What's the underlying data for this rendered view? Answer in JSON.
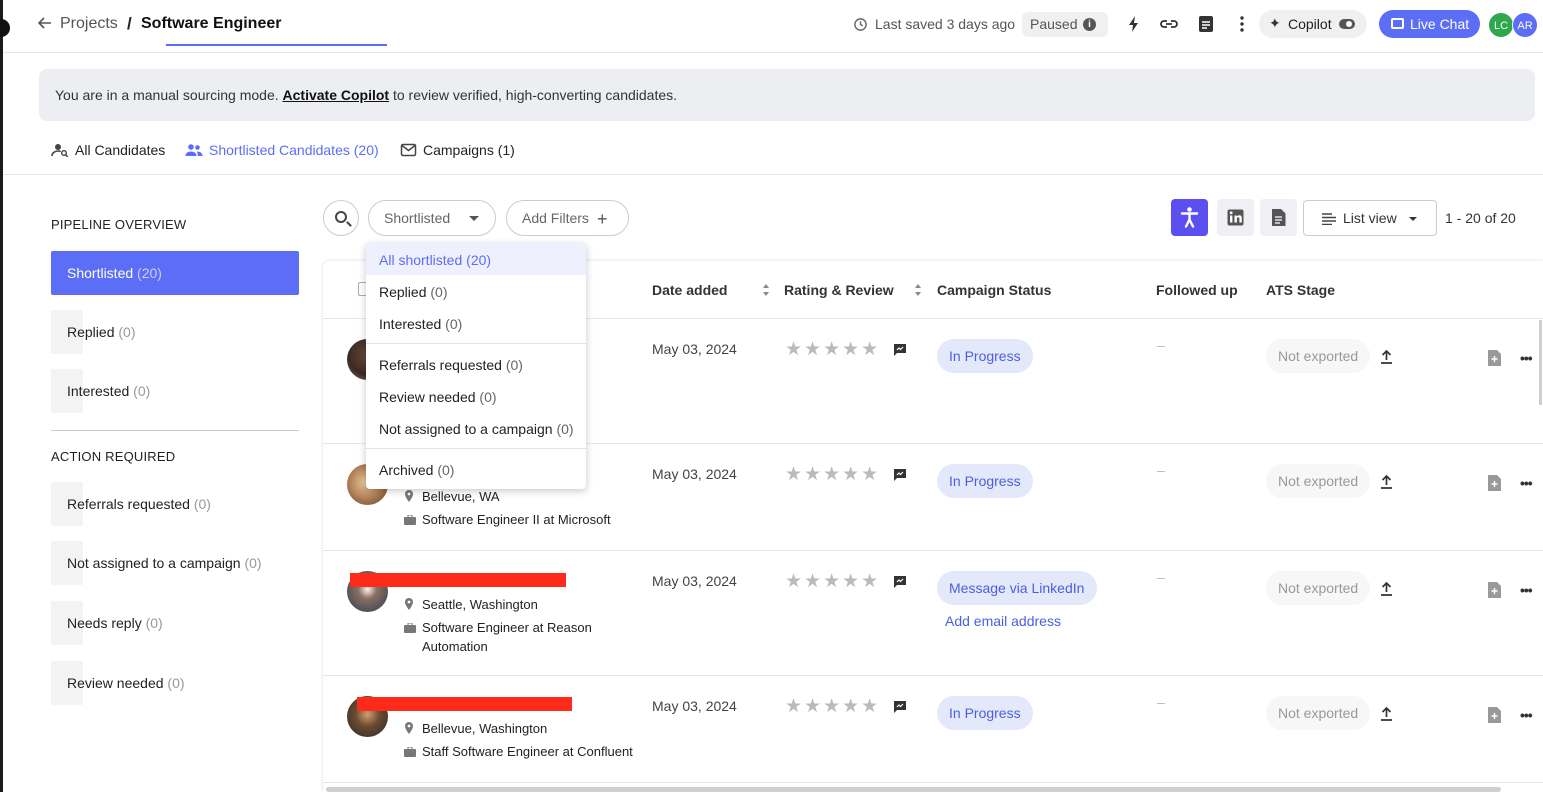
{
  "header": {
    "breadcrumb_parent": "Projects",
    "breadcrumb_separator": "/",
    "project_title": "Software Engineer",
    "last_saved": "Last saved 3 days ago",
    "status": "Paused",
    "copilot_label": "Copilot",
    "live_chat_label": "Live Chat",
    "avatars": [
      "LC",
      "AR"
    ]
  },
  "banner": {
    "text_before": "You are in a manual sourcing mode. ",
    "link": "Activate Copilot",
    "text_after": " to review verified, high-converting candidates."
  },
  "tabs": [
    {
      "label": "All Candidates",
      "active": false
    },
    {
      "label": "Shortlisted Candidates (20)",
      "active": true
    },
    {
      "label": "Campaigns (1)",
      "active": false
    }
  ],
  "sidebar": {
    "pipeline_title": "PIPELINE OVERVIEW",
    "pipeline_items": [
      {
        "label": "Shortlisted",
        "count": "(20)",
        "active": true
      },
      {
        "label": "Replied",
        "count": "(0)",
        "active": false
      },
      {
        "label": "Interested",
        "count": "(0)",
        "active": false
      }
    ],
    "action_title": "ACTION REQUIRED",
    "action_items": [
      {
        "label": "Referrals requested",
        "count": "(0)"
      },
      {
        "label": "Not assigned to a campaign",
        "count": "(0)"
      },
      {
        "label": "Needs reply",
        "count": "(0)"
      },
      {
        "label": "Review needed",
        "count": "(0)"
      }
    ]
  },
  "toolbar": {
    "filter_value": "Shortlisted",
    "add_filters_label": "Add Filters",
    "view_label": "List view",
    "pagination": "1 - 20 of 20"
  },
  "dropdown": {
    "items": [
      {
        "label": "All shortlisted",
        "count": "(20)",
        "selected": true
      },
      {
        "label": "Replied",
        "count": "(0)",
        "selected": false
      },
      {
        "label": "Interested",
        "count": "(0)",
        "selected": false
      },
      {
        "label": "Referrals requested",
        "count": "(0)",
        "selected": false
      },
      {
        "label": "Review needed",
        "count": "(0)",
        "selected": false
      },
      {
        "label": "Not assigned to a campaign",
        "count": "(0)",
        "selected": false
      },
      {
        "label": "Archived",
        "count": "(0)",
        "selected": false
      }
    ]
  },
  "table": {
    "columns": [
      "Date added",
      "Rating & Review",
      "Campaign Status",
      "Followed up",
      "ATS Stage"
    ],
    "rows": [
      {
        "location": "",
        "role": "",
        "role_line2": "",
        "date": "May 03, 2024",
        "status": "In Progress",
        "status_link": "",
        "followed_up": "–",
        "ats": "Not exported"
      },
      {
        "location": "Bellevue, WA",
        "role": "Software Engineer II at Microsoft",
        "role_line2": "",
        "date": "May 03, 2024",
        "status": "In Progress",
        "status_link": "",
        "followed_up": "–",
        "ats": "Not exported"
      },
      {
        "location": "Seattle, Washington",
        "role": "Software Engineer at Reason",
        "role_line2": "Automation",
        "date": "May 03, 2024",
        "status": "Message via LinkedIn",
        "status_link": "Add email address",
        "followed_up": "–",
        "ats": "Not exported"
      },
      {
        "location": "Bellevue, Washington",
        "role": "Staff Software Engineer at Confluent",
        "role_line2": "",
        "date": "May 03, 2024",
        "status": "In Progress",
        "status_link": "",
        "followed_up": "–",
        "ats": "Not exported"
      }
    ],
    "stars": "★★★★★"
  },
  "colors": {
    "accent": "#5b6ef5",
    "primary_button": "#5b4ff0",
    "status_pill_bg": "#e4e8fb",
    "redaction": "#ff2b1a"
  }
}
